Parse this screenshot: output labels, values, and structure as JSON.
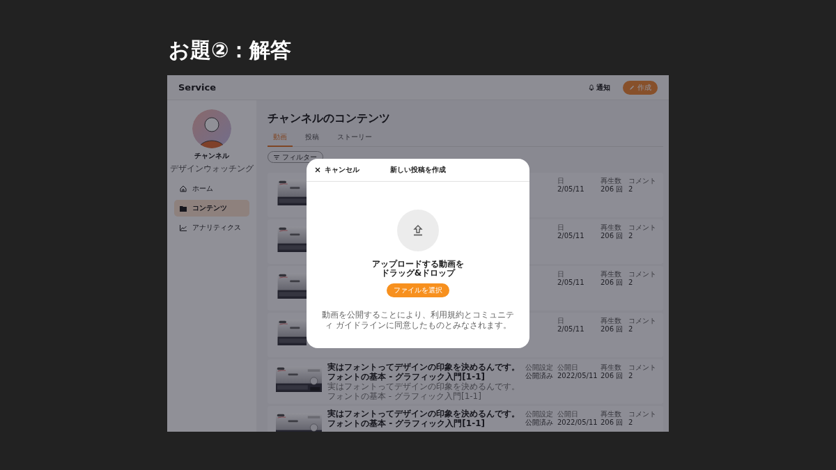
{
  "slide_title": "お題②：解答",
  "header": {
    "logo": "Service",
    "notifications": "通知",
    "create_button": "作成"
  },
  "sidebar": {
    "channel_name": "チャンネル",
    "channel_subtitle": "デザインウォッチング",
    "items": [
      {
        "label": "ホーム",
        "selected": false
      },
      {
        "label": "コンテンツ",
        "selected": true
      },
      {
        "label": "アナリティクス",
        "selected": false
      }
    ]
  },
  "main": {
    "title": "チャンネルのコンテンツ",
    "tabs": [
      {
        "label": "動画",
        "selected": true
      },
      {
        "label": "投稿",
        "selected": false
      },
      {
        "label": "ストーリー",
        "selected": false
      }
    ],
    "filter": "フィルター",
    "rows": [
      {
        "kind": "partial",
        "date_label": "日",
        "date": "2/05/11",
        "views_label": "再生数",
        "views": "206 回",
        "comments_label": "コメント",
        "comments": "2"
      },
      {
        "kind": "partial",
        "date_label": "日",
        "date": "2/05/11",
        "views_label": "再生数",
        "views": "206 回",
        "comments_label": "コメント",
        "comments": "2"
      },
      {
        "kind": "partial",
        "date_label": "日",
        "date": "2/05/11",
        "views_label": "再生数",
        "views": "206 回",
        "comments_label": "コメント",
        "comments": "2"
      },
      {
        "kind": "partial",
        "date_label": "日",
        "date": "2/05/11",
        "views_label": "再生数",
        "views": "206 回",
        "comments_label": "コメント",
        "comments": "2"
      },
      {
        "kind": "full",
        "title": "実はフォントってデザインの印象を決めるんです。フォントの基本 - グラフィック入門[1-1]",
        "description": "実はフォントってデザインの印象を決めるんです。フォントの基本 - グラフィック入門[1-1]",
        "status_label": "公開設定",
        "status": "公開済み",
        "date_label": "公開日",
        "date": "2022/05/11",
        "views_label": "再生数",
        "views": "206 回",
        "comments_label": "コメント",
        "comments": "2"
      },
      {
        "kind": "full",
        "title": "実はフォントってデザインの印象を決めるんです。フォントの基本 - グラフィック入門[1-1]",
        "status_label": "公開設定",
        "status": "公開済み",
        "date_label": "公開日",
        "date": "2022/05/11",
        "views_label": "再生数",
        "views": "206 回",
        "comments_label": "コメント",
        "comments": "2"
      }
    ]
  },
  "modal": {
    "cancel": "キャンセル",
    "title": "新しい投稿を作成",
    "drop_text": "アップロードする動画をドラッグ&ドロップ",
    "select_button": "ファイルを選択",
    "note": "動画を公開することにより、利用規約とコミュニティ ガイドラインに同意したものとみなされます。"
  }
}
